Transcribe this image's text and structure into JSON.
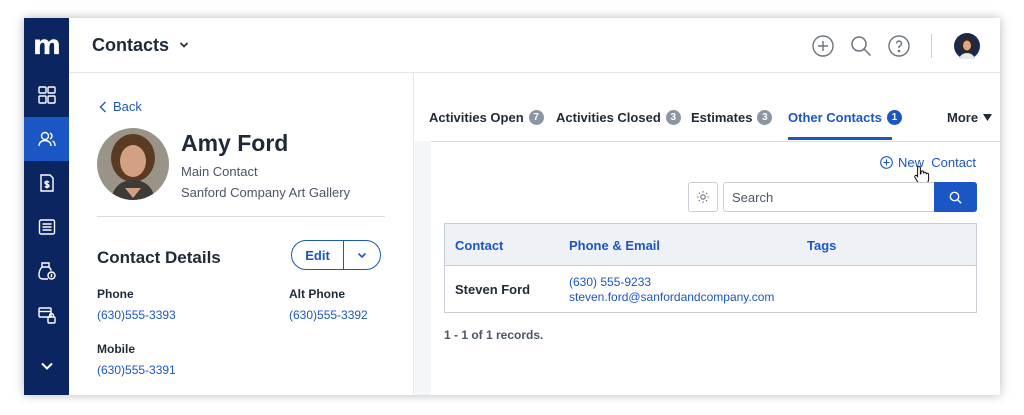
{
  "app": {
    "logo_letter": "m"
  },
  "sidebar": {
    "items": [
      {
        "icon": "dashboard-icon"
      },
      {
        "icon": "contacts-icon",
        "active": true
      },
      {
        "icon": "document-dollar-icon"
      },
      {
        "icon": "list-icon"
      },
      {
        "icon": "money-bag-icon"
      },
      {
        "icon": "lock-card-icon"
      },
      {
        "icon": "chevron-down-icon"
      }
    ]
  },
  "header": {
    "title": "Contacts"
  },
  "left": {
    "back_label": "Back",
    "name": "Amy Ford",
    "role": "Main Contact",
    "company": "Sanford Company Art Gallery",
    "details_title": "Contact Details",
    "edit_label": "Edit",
    "fields": {
      "phone_label": "Phone",
      "phone_value": "(630)555-3393",
      "alt_phone_label": "Alt Phone",
      "alt_phone_value": "(630)555-3392",
      "mobile_label": "Mobile",
      "mobile_value": "(630)555-3391"
    }
  },
  "tabs": [
    {
      "label": "Activities Open",
      "count": "7"
    },
    {
      "label": "Activities Closed",
      "count": "3"
    },
    {
      "label": "Estimates",
      "count": "3"
    },
    {
      "label": "Other Contacts",
      "count": "1",
      "active": true
    },
    {
      "label": "More"
    }
  ],
  "panel": {
    "new_contact_label": "New  Contact",
    "search_placeholder": "Search",
    "columns": [
      "Contact",
      "Phone & Email",
      "Tags"
    ],
    "rows": [
      {
        "name": "Steven Ford",
        "phone": "(630) 555-9233",
        "email": "steven.ford@sanfordandcompany.com",
        "tags": ""
      }
    ],
    "records_text": "1 - 1 of 1 records."
  },
  "colors": {
    "nav": "#0b2561",
    "nav_active": "#1a56c4",
    "accent": "#1a56c4"
  }
}
